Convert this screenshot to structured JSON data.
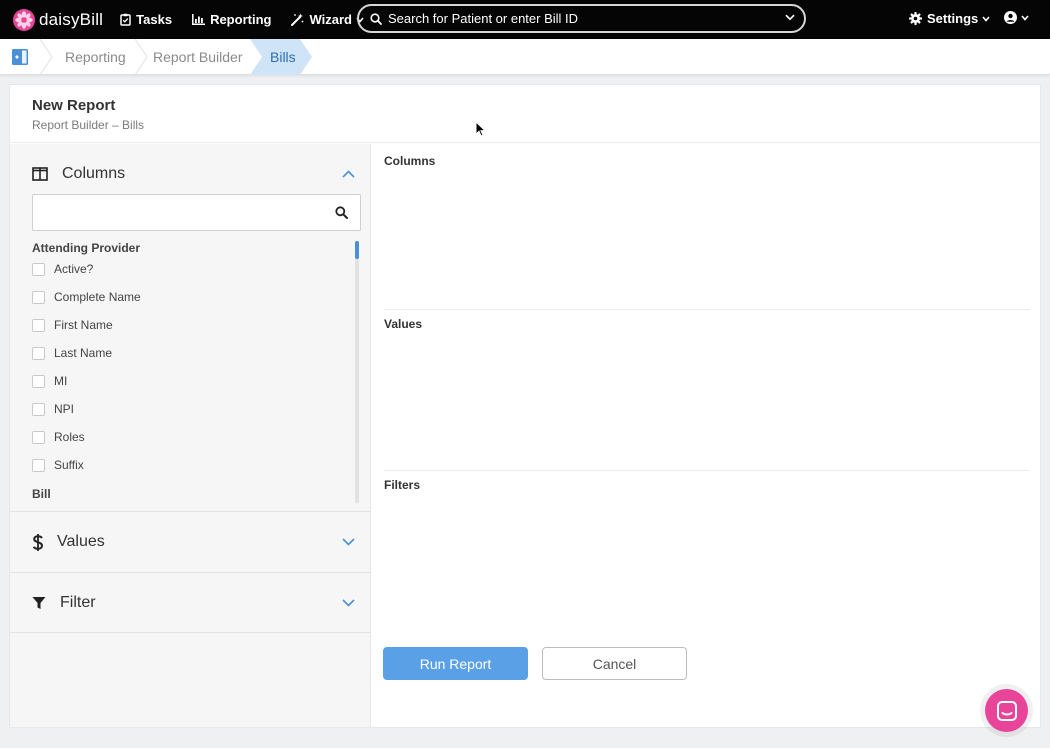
{
  "nav": {
    "brand": "daisyBill",
    "tasks": "Tasks",
    "reporting": "Reporting",
    "wizard": "Wizard",
    "search_placeholder": "Search for Patient or enter Bill ID",
    "settings": "Settings",
    "icons": [
      "daisy-logo-icon",
      "clipboard-icon",
      "bar-chart-icon",
      "magic-wand-icon",
      "search-icon",
      "gear-icon",
      "user-circle-icon"
    ]
  },
  "breadcrumb": [
    "Reporting",
    "Report Builder",
    "Bills"
  ],
  "header": {
    "title": "New Report",
    "subtitle": "Report Builder – Bills"
  },
  "left": {
    "columns_title": "Columns",
    "search_value": "",
    "groups": [
      {
        "label": "Attending Provider",
        "items": [
          "Active?",
          "Complete Name",
          "First Name",
          "Last Name",
          "MI",
          "NPI",
          "Roles",
          "Suffix"
        ]
      },
      {
        "label": "Bill",
        "items": []
      }
    ],
    "values_title": "Values",
    "filter_title": "Filter"
  },
  "right": {
    "columns_label": "Columns",
    "values_label": "Values",
    "filters_label": "Filters"
  },
  "buttons": {
    "run": "Run Report",
    "cancel": "Cancel"
  },
  "colors": {
    "nav_bg": "#050505",
    "accent": "#5aa0e6",
    "brand_pink": "#e8459a",
    "active_crumb": "#cfe4f7"
  }
}
